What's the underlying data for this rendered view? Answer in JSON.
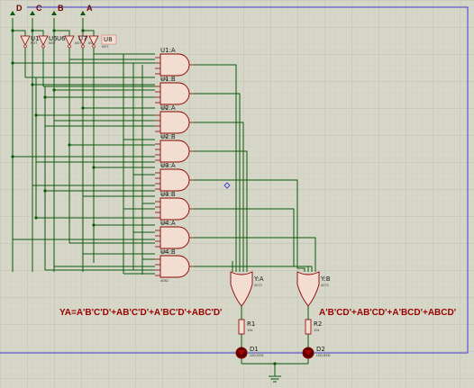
{
  "inputs": [
    {
      "label": "D"
    },
    {
      "label": "C"
    },
    {
      "label": "B"
    },
    {
      "label": "A"
    }
  ],
  "not_gates": [
    {
      "ref": "U1",
      "type": "NOT"
    },
    {
      "ref": "U5",
      "type": "NOT"
    },
    {
      "ref": "U6",
      "type": "NOT"
    },
    {
      "ref": "U7",
      "type": "NOT"
    },
    {
      "ref": "U8",
      "type": "NOT"
    }
  ],
  "and_gates": [
    {
      "ref": "U1:A",
      "part": "4082"
    },
    {
      "ref": "U1:B",
      "part": "4082"
    },
    {
      "ref": "U2:A",
      "part": "4082"
    },
    {
      "ref": "U2:B",
      "part": "4082"
    },
    {
      "ref": "U3:A",
      "part": "4082"
    },
    {
      "ref": "U3:B",
      "part": "4082"
    },
    {
      "ref": "U4:A",
      "part": "4082"
    },
    {
      "ref": "U4:B",
      "part": "4082"
    }
  ],
  "or_gates": [
    {
      "ref": "Y:A",
      "part": "4072"
    },
    {
      "ref": "Y:B",
      "part": "4072"
    }
  ],
  "resistors": [
    {
      "ref": "R1",
      "value": "10k"
    },
    {
      "ref": "R2",
      "value": "10k"
    }
  ],
  "leds": [
    {
      "ref": "D1",
      "part": "LED-RED"
    },
    {
      "ref": "D2",
      "part": "LED-RED"
    }
  ],
  "equations": {
    "ya": "YA=A'B'C'D'+AB'C'D'+A'BC'D'+ABC'D'",
    "yb": "A'B'CD'+AB'CD'+A'BCD'+ABCD'"
  },
  "colors": {
    "background": "#d7d7c9",
    "grid": "#c3c3b3",
    "wire": "#0a5a0a",
    "component": "#8b0000",
    "gate_fill": "#f3ddd0",
    "border": "#3b3bd4",
    "equation": "#9b0000"
  }
}
